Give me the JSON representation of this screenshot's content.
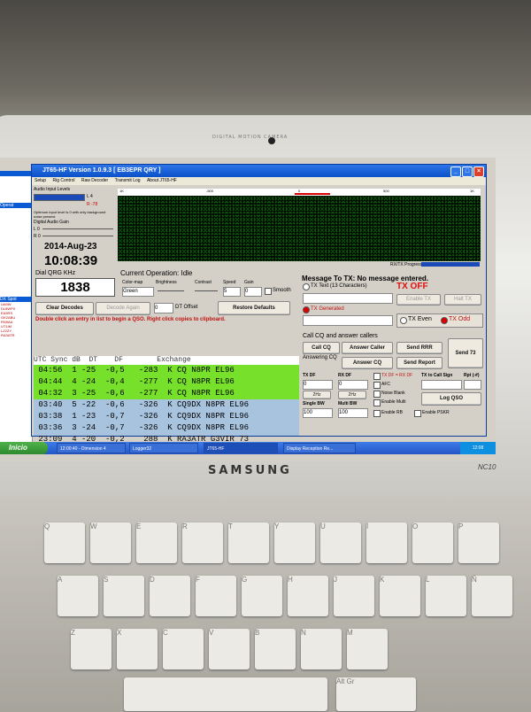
{
  "window": {
    "title": "JT65-HF Version 1.0.9.3 [ EB3EPR QRY ]",
    "menu": [
      "Setup",
      "Rig Control",
      "Raw Decoder",
      "Transmit Log",
      "About JT65-HF"
    ]
  },
  "audio": {
    "input_levels": "Audio Input Levels",
    "l_label": "L 4",
    "r_label": "R -78",
    "optimum": "Optimum input level is 0 with only background noise present.",
    "gain_label": "Digital Audio Gain",
    "gain_l": "L 0",
    "gain_r": "R 0"
  },
  "date": "2014-Aug-23",
  "time": "10:08:39",
  "dial_label": "Dial QRG KHz",
  "dial_value": "1838",
  "operation": {
    "label": "Current Operation: Idle"
  },
  "controls": {
    "colormap": "Color-map",
    "brightness": "Brightness",
    "contrast": "Contrast",
    "speed": "Speed",
    "gain": "Gain",
    "colormap_value": "Green",
    "speed_value": "5",
    "gain_value": "0",
    "smooth": "Smooth",
    "restore": "Restore Defaults"
  },
  "decode_buttons": {
    "clear": "Clear Decodes",
    "again": "Decode Again",
    "dt_value": "0",
    "dt_label": "DT Offset"
  },
  "instruction": "Double click an entry in list to begin a QSO.  Right click copies to clipboard.",
  "table": {
    "headers": [
      "UTC",
      "Sync",
      "dB",
      "DT",
      "DF",
      "Exchange"
    ],
    "rows": [
      {
        "utc": "04:56",
        "sync": "1",
        "db": "-25",
        "dt": "-0,5",
        "df": "-283",
        "ex": "K CQ N8PR EL96"
      },
      {
        "utc": "04:44",
        "sync": "4",
        "db": "-24",
        "dt": "-0,4",
        "df": "-277",
        "ex": "K CQ N8PR EL96"
      },
      {
        "utc": "04:32",
        "sync": "3",
        "db": "-25",
        "dt": "-0,6",
        "df": "-277",
        "ex": "K CQ N8PR EL96"
      },
      {
        "utc": "03:40",
        "sync": "5",
        "db": "-22",
        "dt": "-0,6",
        "df": "-326",
        "ex": "K CQ9DX N8PR EL96"
      },
      {
        "utc": "03:38",
        "sync": "1",
        "db": "-23",
        "dt": "-0,7",
        "df": "-326",
        "ex": "K CQ9DX N8PR EL96"
      },
      {
        "utc": "03:36",
        "sync": "3",
        "db": "-24",
        "dt": "-0,7",
        "df": "-326",
        "ex": "K CQ9DX N8PR EL96"
      },
      {
        "utc": "23:09",
        "sync": "4",
        "db": "-20",
        "dt": "-0,2",
        "df": "288",
        "ex": "K RA3ATR G3VIR 73"
      }
    ]
  },
  "tx": {
    "message_label": "Message To TX:  No message entered.",
    "tx_text": "TX Text (13 Characters)",
    "tx_off": "TX OFF",
    "enable_tx": "Enable TX",
    "halt_tx": "Halt TX",
    "tx_generated": "TX Generated",
    "tx_even": "TX Even",
    "tx_odd": "TX Odd",
    "progress": "RX/TX Progress"
  },
  "cq": {
    "label": "Call CQ and answer callers",
    "call_cq": "Call CQ",
    "answer_caller": "Answer Caller",
    "send_rrr": "Send RRR",
    "send73": "Send 73",
    "answering": "Answering CQ",
    "answer_cq": "Answer CQ",
    "send_report": "Send Report"
  },
  "df": {
    "tx_df": "TX DF",
    "rx_df": "RX DF",
    "tx_df_value": "0",
    "rx_df_value": "0",
    "step_tx": "2Hz",
    "step_rx": "2Hz",
    "txrx": "TX DF = RX DF",
    "afc": "AFC",
    "noise": "Noise Blank",
    "multi": "Enable Multi",
    "rb": "Enable RB",
    "psk": "Enable PSKR",
    "tocall": "TX to Call Sign",
    "rpt": "Rpt (-#)",
    "single_bw": "Single BW",
    "multi_bw": "Multi BW",
    "single_value": "100",
    "multi_value": "100",
    "log": "Log QSO"
  },
  "taskbar": {
    "start": "Inicio",
    "tasks": [
      "12:00:40 - Dimension 4",
      "Logger32",
      "JT65-HF",
      "Display Reception Re..."
    ],
    "clock": "12:08"
  },
  "ruler": {
    "ticks": [
      "1K",
      "-500",
      "0",
      "500",
      "1K"
    ]
  },
  "bezel": {
    "camera": "DIGITAL MOTION CAMERA",
    "brand": "SAMSUNG",
    "model": "NC10"
  },
  "left_app": {
    "items": [
      "Operat",
      "DX Spot"
    ]
  },
  "keys": [
    "Q",
    "W",
    "E",
    "R",
    "T",
    "Y",
    "U",
    "I",
    "O",
    "P",
    "A",
    "S",
    "D",
    "F",
    "G",
    "H",
    "J",
    "K",
    "L",
    "Ñ",
    "Z",
    "X",
    "C",
    "V",
    "B",
    "N",
    "M",
    "Alt Gr"
  ]
}
